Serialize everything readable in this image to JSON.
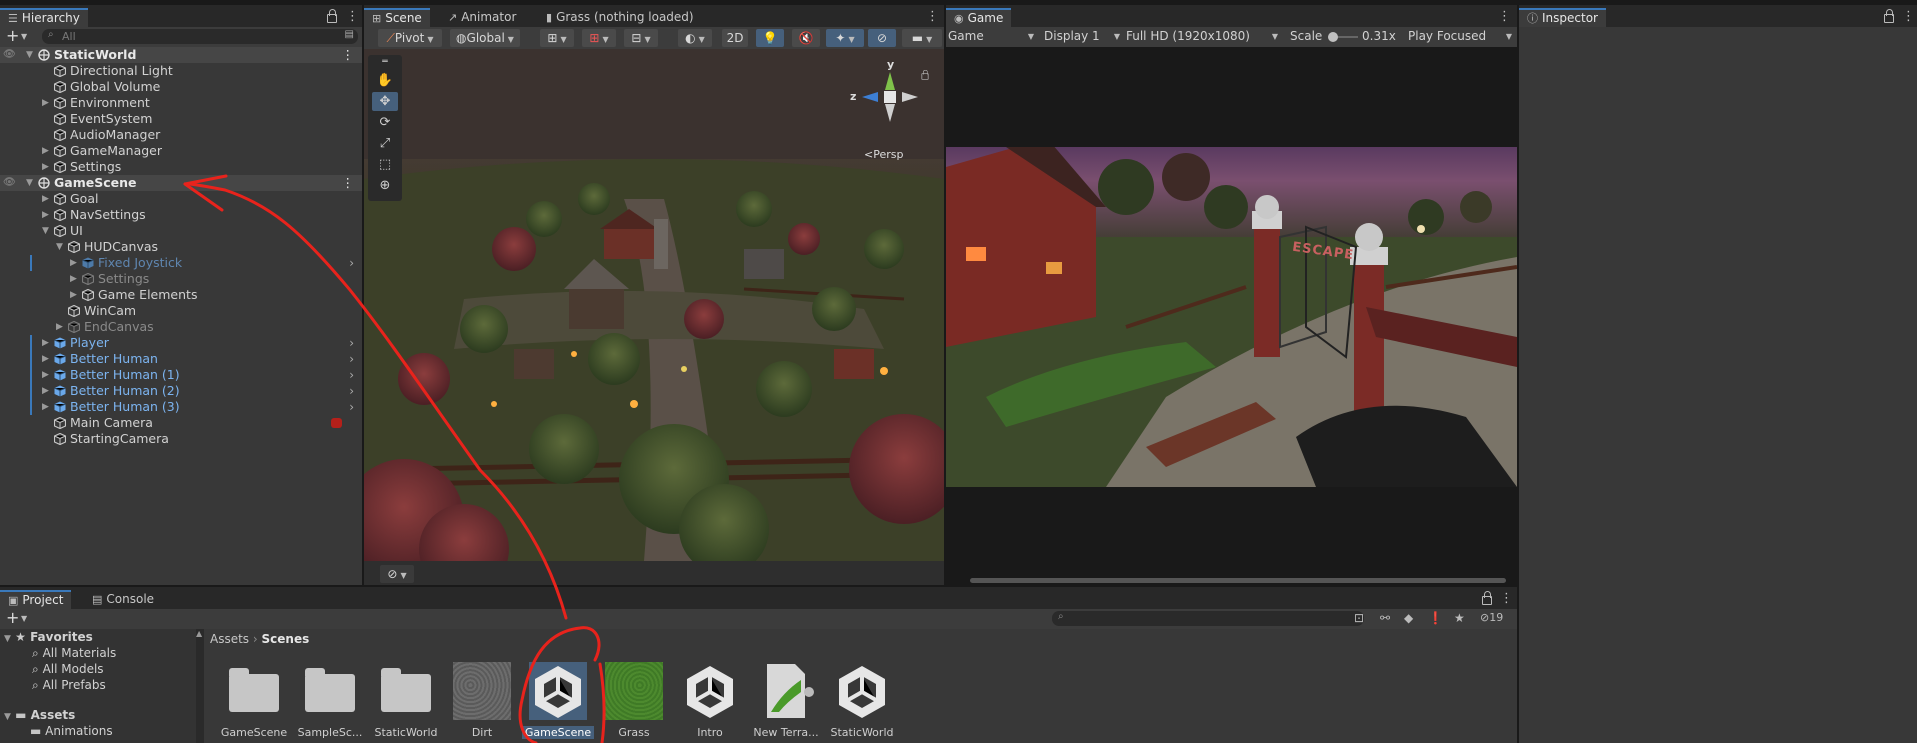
{
  "hierarchy": {
    "tab": "Hierarchy",
    "add": "+",
    "search_placeholder": "All",
    "rows": [
      {
        "label": "StaticWorld",
        "kind": "scene",
        "indent": 0,
        "arrow": "▼"
      },
      {
        "label": "Directional Light",
        "kind": "obj",
        "indent": 1,
        "arrow": ""
      },
      {
        "label": "Global Volume",
        "kind": "obj",
        "indent": 1,
        "arrow": ""
      },
      {
        "label": "Environment",
        "kind": "obj",
        "indent": 1,
        "arrow": "▶"
      },
      {
        "label": "EventSystem",
        "kind": "obj",
        "indent": 1,
        "arrow": ""
      },
      {
        "label": "AudioManager",
        "kind": "obj",
        "indent": 1,
        "arrow": ""
      },
      {
        "label": "GameManager",
        "kind": "obj",
        "indent": 1,
        "arrow": "▶"
      },
      {
        "label": "Settings",
        "kind": "obj",
        "indent": 1,
        "arrow": "▶"
      },
      {
        "label": "GameScene",
        "kind": "scene",
        "indent": 0,
        "arrow": "▼"
      },
      {
        "label": "Goal",
        "kind": "obj",
        "indent": 1,
        "arrow": "▶"
      },
      {
        "label": "NavSettings",
        "kind": "obj",
        "indent": 1,
        "arrow": "▶"
      },
      {
        "label": "UI",
        "kind": "obj",
        "indent": 1,
        "arrow": "▼"
      },
      {
        "label": "HUDCanvas",
        "kind": "obj",
        "indent": 2,
        "arrow": "▼"
      },
      {
        "label": "Fixed Joystick",
        "kind": "prefabdisabled",
        "indent": 3,
        "arrow": "▶"
      },
      {
        "label": "Settings",
        "kind": "disabled",
        "indent": 3,
        "arrow": "▶"
      },
      {
        "label": "Game Elements",
        "kind": "obj",
        "indent": 3,
        "arrow": "▶"
      },
      {
        "label": "WinCam",
        "kind": "obj",
        "indent": 2,
        "arrow": ""
      },
      {
        "label": "EndCanvas",
        "kind": "disabled",
        "indent": 2,
        "arrow": "▶"
      },
      {
        "label": "Player",
        "kind": "prefab",
        "indent": 1,
        "arrow": "▶"
      },
      {
        "label": "Better Human",
        "kind": "prefab",
        "indent": 1,
        "arrow": "▶"
      },
      {
        "label": "Better Human (1)",
        "kind": "prefab",
        "indent": 1,
        "arrow": "▶"
      },
      {
        "label": "Better Human (2)",
        "kind": "prefab",
        "indent": 1,
        "arrow": "▶"
      },
      {
        "label": "Better Human (3)",
        "kind": "prefab",
        "indent": 1,
        "arrow": "▶"
      },
      {
        "label": "Main Camera",
        "kind": "obj",
        "indent": 1,
        "arrow": ""
      },
      {
        "label": "StartingCamera",
        "kind": "obj",
        "indent": 1,
        "arrow": ""
      }
    ]
  },
  "scene_view": {
    "tabs": [
      "Scene",
      "Animator",
      "Grass (nothing loaded)"
    ],
    "pivot": "Pivot",
    "global": "Global",
    "mode_2d": "2D",
    "gizmo_y": "y",
    "gizmo_z": "z",
    "persp": "Persp"
  },
  "game_view": {
    "tab": "Game",
    "mode": "Game",
    "display": "Display 1",
    "resolution": "Full HD (1920x1080)",
    "scale_label": "Scale",
    "scale_value": "0.31x",
    "play_mode": "Play Focused",
    "sign": "ESCAPE"
  },
  "inspector": {
    "tab": "Inspector"
  },
  "project": {
    "tabs": [
      "Project",
      "Console"
    ],
    "add": "+",
    "hidden_count": "19",
    "breadcrumb": [
      "Assets",
      "Scenes"
    ],
    "favorites_label": "Favorites",
    "favorites": [
      "All Materials",
      "All Models",
      "All Prefabs"
    ],
    "assets_label": "Assets",
    "asset_folders": [
      "Animations"
    ],
    "items": [
      {
        "name": "GameScene",
        "type": "folder"
      },
      {
        "name": "SampleSc...",
        "type": "folder"
      },
      {
        "name": "StaticWorld",
        "type": "folder"
      },
      {
        "name": "Dirt",
        "type": "dirt"
      },
      {
        "name": "GameScene",
        "type": "unity",
        "selected": true
      },
      {
        "name": "Grass",
        "type": "grass"
      },
      {
        "name": "Intro",
        "type": "unity"
      },
      {
        "name": "New Terra...",
        "type": "terrain"
      },
      {
        "name": "StaticWorld",
        "type": "unity"
      }
    ]
  },
  "colors": {
    "accent": "#3a79bb",
    "annotation": "#e8231c",
    "prefab_text": "#7cb4f0"
  }
}
